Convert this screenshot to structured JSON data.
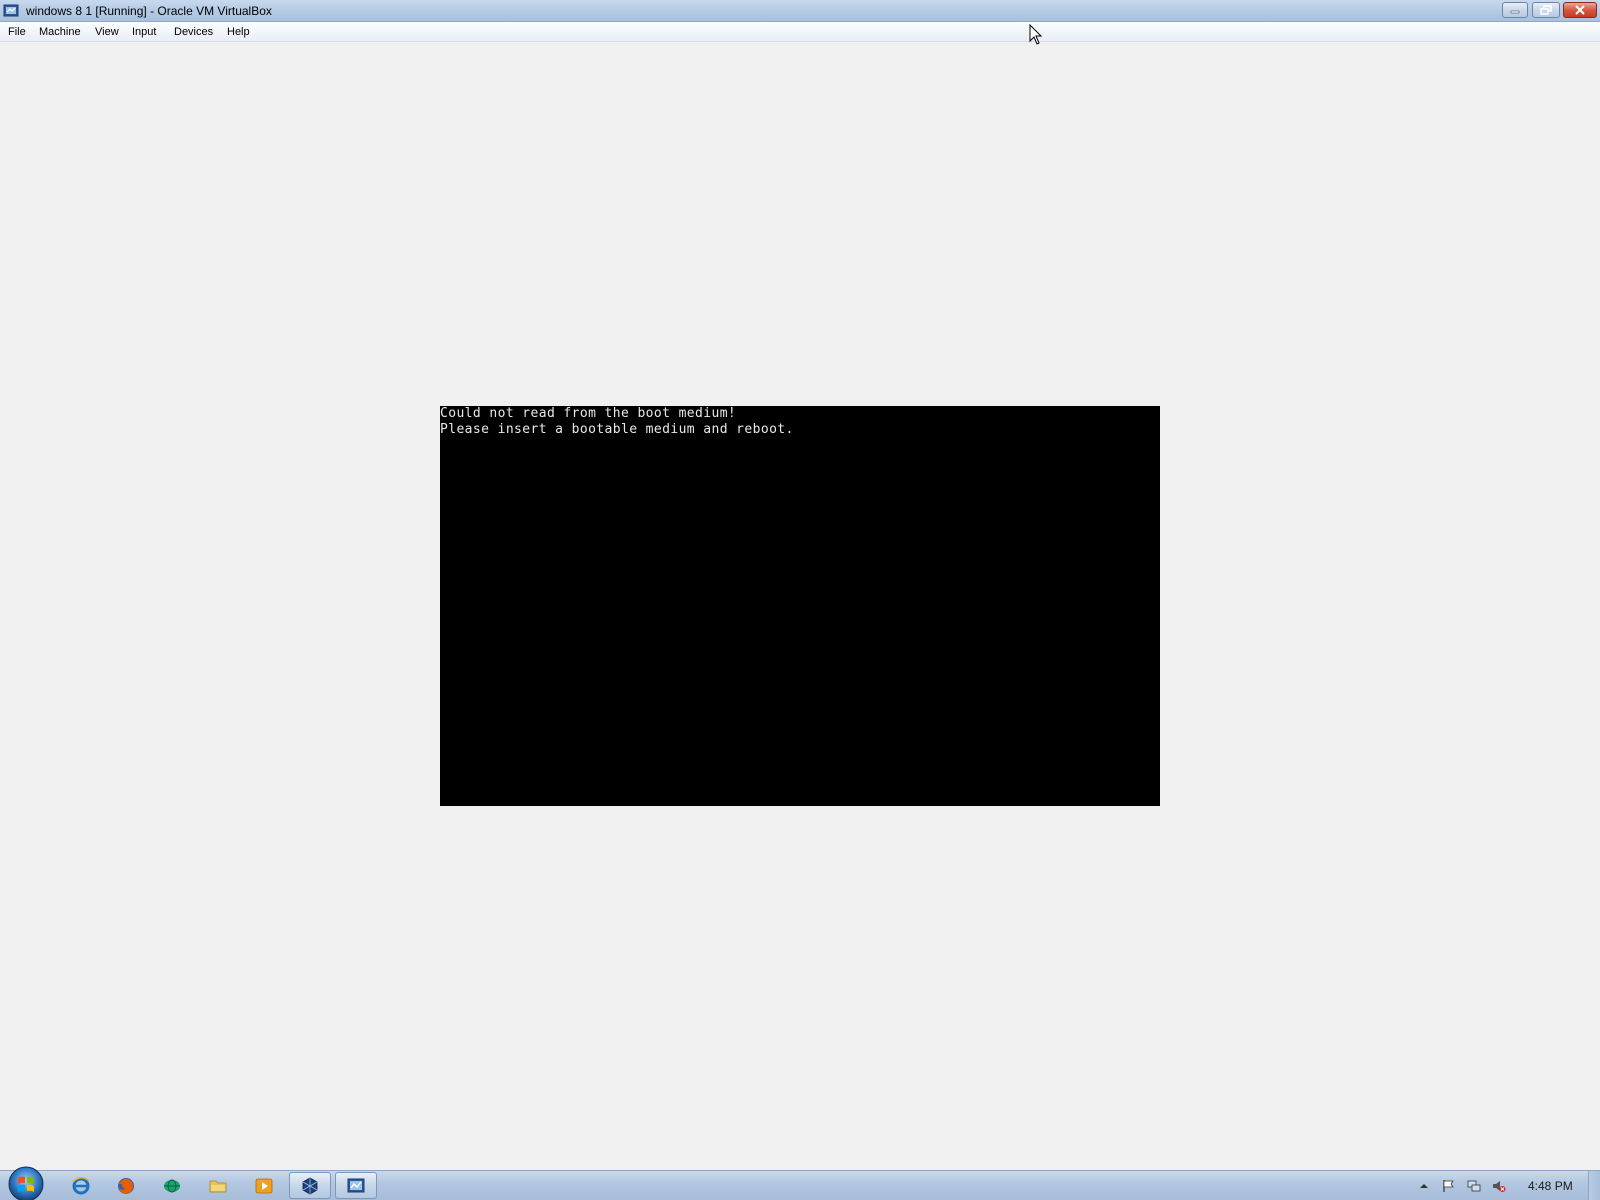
{
  "window": {
    "title": "windows 8 1 [Running] - Oracle VM VirtualBox",
    "controls": {
      "minimize": "minimize",
      "restore": "restore",
      "close": "close"
    }
  },
  "menubar": {
    "items": [
      {
        "label": "File"
      },
      {
        "label": "Machine"
      },
      {
        "label": "View"
      },
      {
        "label": "Input"
      },
      {
        "label": "Devices"
      },
      {
        "label": "Help"
      }
    ]
  },
  "vm_screen": {
    "lines": [
      "Could not read from the boot medium!",
      "Please insert a bootable medium and reboot."
    ]
  },
  "taskbar": {
    "pinned": [
      {
        "icon": "internet-explorer-icon"
      },
      {
        "icon": "firefox-icon"
      },
      {
        "icon": "network-globe-icon"
      },
      {
        "icon": "folder-icon"
      },
      {
        "icon": "media-player-icon"
      },
      {
        "icon": "virtualbox-manager-icon"
      },
      {
        "icon": "virtualbox-vm-icon"
      }
    ],
    "tray": {
      "icons": [
        "show-hidden-icons-arrow",
        "action-center-flag-icon",
        "network-icon",
        "volume-muted-icon"
      ],
      "clock": "4:48 PM"
    }
  },
  "colors": {
    "titlebar": "#b5cbe4",
    "vm_background": "#000000",
    "vm_text": "#e8e8e8",
    "desktop": "#f0f0f0"
  }
}
